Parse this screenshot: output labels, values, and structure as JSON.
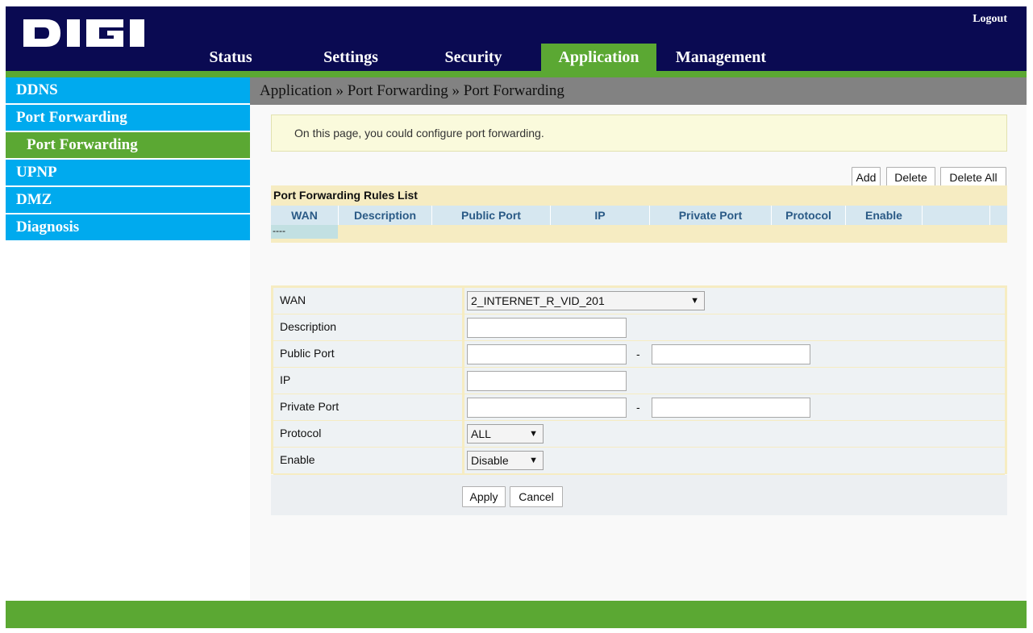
{
  "brand": {
    "logo_text": "DIGI",
    "colors": {
      "header": "#0a0a52",
      "accent": "#5ba833",
      "sidebar": "#00aaee",
      "breadcrumb": "#828282"
    }
  },
  "header": {
    "logout_label": "Logout",
    "tabs": [
      {
        "label": "Status",
        "active": false
      },
      {
        "label": "Settings",
        "active": false
      },
      {
        "label": "Security",
        "active": false
      },
      {
        "label": "Application",
        "active": true
      },
      {
        "label": "Management",
        "active": false
      }
    ]
  },
  "sidebar": {
    "items": [
      {
        "label": "DDNS",
        "sub": false
      },
      {
        "label": "Port Forwarding",
        "sub": false
      },
      {
        "label": "Port Forwarding",
        "sub": true,
        "selected": true
      },
      {
        "label": "UPNP",
        "sub": false
      },
      {
        "label": "DMZ",
        "sub": false
      },
      {
        "label": "Diagnosis",
        "sub": false
      }
    ]
  },
  "main": {
    "breadcrumb": "Application » Port Forwarding » Port Forwarding",
    "info_text": "On this page, you could configure port forwarding.",
    "actions": {
      "add": "Add",
      "delete": "Delete",
      "delete_all": "Delete All"
    },
    "rules": {
      "title": "Port Forwarding Rules List",
      "columns": [
        "WAN",
        "Description",
        "Public Port",
        "IP",
        "Private Port",
        "Protocol",
        "Enable"
      ],
      "empty_row": "----"
    },
    "form": {
      "wan": {
        "label": "WAN",
        "value": "2_INTERNET_R_VID_201"
      },
      "description": {
        "label": "Description",
        "value": ""
      },
      "public_port": {
        "label": "Public Port",
        "start": "",
        "separator": "-",
        "end": ""
      },
      "ip": {
        "label": "IP",
        "value": ""
      },
      "private_port": {
        "label": "Private Port",
        "start": "",
        "separator": "-",
        "end": ""
      },
      "protocol": {
        "label": "Protocol",
        "value": "ALL"
      },
      "enable": {
        "label": "Enable",
        "value": "Disable"
      },
      "apply_label": "Apply",
      "cancel_label": "Cancel",
      "dropdown_icon": "chevron-down-icon"
    }
  }
}
